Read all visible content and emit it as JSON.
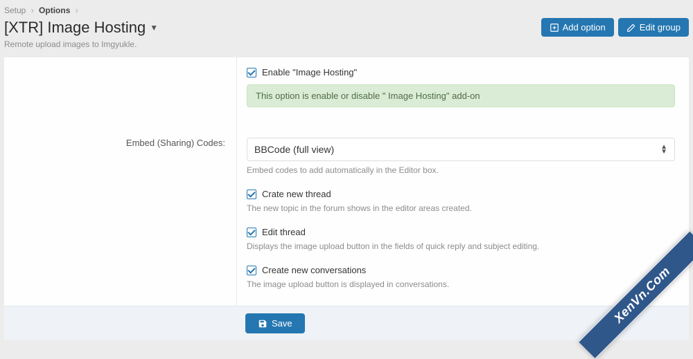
{
  "breadcrumb": {
    "item1": "Setup",
    "item2": "Options"
  },
  "header": {
    "title": "[XTR] Image Hosting",
    "subtitle": "Remote upload images to Imgyukle.",
    "add_option": "Add option",
    "edit_group": "Edit group"
  },
  "options": {
    "enable": {
      "label": "Enable \"Image Hosting\"",
      "hint": "This option is enable or disable \" Image Hosting\" add-on"
    },
    "embed": {
      "label": "Embed (Sharing) Codes:",
      "value": "BBCode (full view)",
      "hint": "Embed codes to add automatically in the Editor box."
    },
    "create_thread": {
      "label": "Crate new thread",
      "hint": "The new topic in the forum shows in the editor areas created."
    },
    "edit_thread": {
      "label": "Edit thread",
      "hint": "Displays the image upload button in the fields of quick reply and subject editing."
    },
    "create_conv": {
      "label": "Create new conversations",
      "hint": "The image upload button is displayed in conversations."
    }
  },
  "footer": {
    "save": "Save"
  },
  "watermark": "XenVn.Com"
}
